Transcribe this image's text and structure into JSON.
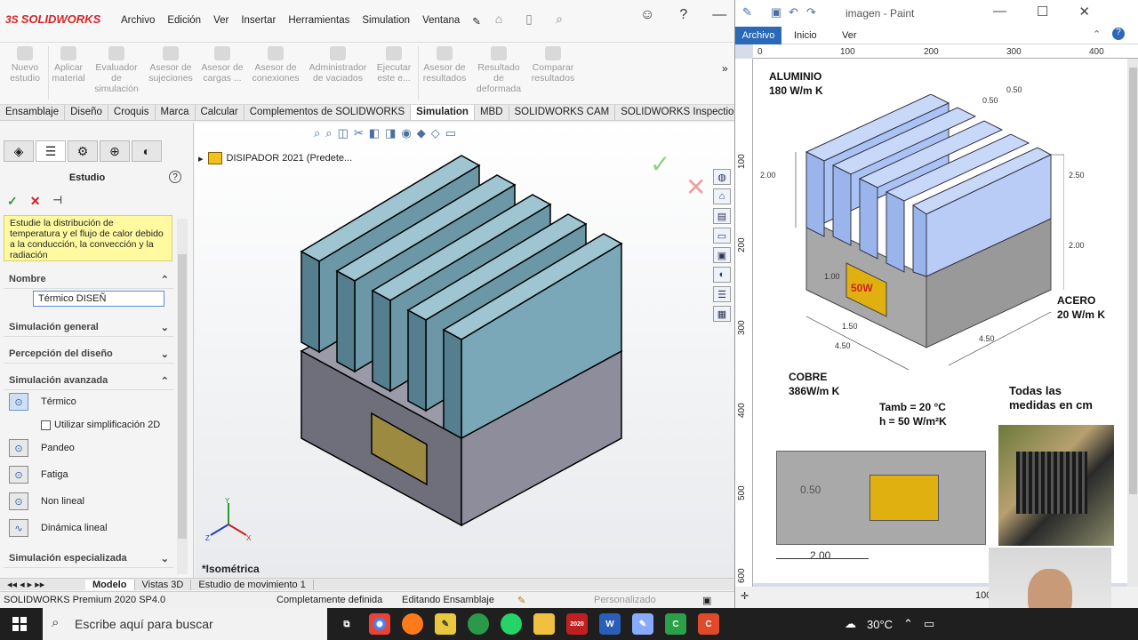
{
  "solidworks": {
    "logo": "SOLIDWORKS",
    "logo_mark": "3S",
    "menu": [
      "Archivo",
      "Edición",
      "Ver",
      "Insertar",
      "Herramientas",
      "Simulation",
      "Ventana"
    ],
    "ribbon": [
      {
        "label": "Nuevo estudio"
      },
      {
        "label": "Aplicar material"
      },
      {
        "label": "Evaluador de simulación"
      },
      {
        "label": "Asesor de sujeciones"
      },
      {
        "label": "Asesor de cargas ..."
      },
      {
        "label": "Asesor de conexiones"
      },
      {
        "label": "Administrador de vaciados"
      },
      {
        "label": "Ejecutar este e..."
      },
      {
        "label": "Asesor de resultados"
      },
      {
        "label": "Resultado de deformada"
      },
      {
        "label": "Comparar resultados"
      }
    ],
    "tabs": [
      "Ensamblaje",
      "Diseño",
      "Croquis",
      "Marca",
      "Calcular",
      "Complementos de SOLIDWORKS",
      "Simulation",
      "MBD",
      "SOLIDWORKS CAM",
      "SOLIDWORKS Inspection"
    ],
    "active_tab": "Simulation",
    "pane": {
      "title": "Estudio",
      "help": "?",
      "info": "Estudie la distribución de temperatura y el flujo de calor debido a la conducción, la convección y la radiación",
      "nombre_label": "Nombre",
      "nombre_value": "Térmico  DISEÑ",
      "sections": [
        "Simulación general",
        "Percepción del diseño",
        "Simulación avanzada",
        "Simulación especializada"
      ],
      "options": [
        "Térmico",
        "Pandeo",
        "Fatiga",
        "Non lineal",
        "Dinámica lineal"
      ],
      "checkbox": "Utilizar simplificación 2D"
    },
    "tree_item": "DISIPADOR 2021  (Predete...",
    "view_label": "*Isométrica",
    "bottom_tabs": [
      "Modelo",
      "Vistas 3D",
      "Estudio de movimiento 1"
    ],
    "status": {
      "version": "SOLIDWORKS Premium 2020 SP4.0",
      "state": "Completamente definida",
      "mode": "Editando Ensamblaje",
      "units": "Personalizado"
    },
    "colors": {
      "fin": "#7aa8b8",
      "base": "#7f7f8e",
      "copper": "#a08a40"
    }
  },
  "paint": {
    "title": "imagen - Paint",
    "file_tab": "Archivo",
    "tabs": [
      "Inicio",
      "Ver"
    ],
    "ruler_h": [
      "0",
      "100",
      "200",
      "300",
      "400"
    ],
    "ruler_v": [
      "100",
      "200",
      "300",
      "400",
      "500",
      "600"
    ],
    "zoom": "100",
    "figure": {
      "aluminio": "ALUMINIO",
      "aluminio_k": "180 W/m K",
      "acero": "ACERO",
      "acero_k": "20 W/m K",
      "cobre": "COBRE",
      "cobre_k": "386W/m K",
      "power": "50W",
      "tamb": "Tamb = 20 °C",
      "h": "h = 50 W/m²K",
      "note1": "Todas las",
      "note2": "medidas en cm",
      "dims": [
        "0.50",
        "0.50",
        "2.00",
        "2.50",
        "2.00",
        "1.00",
        "1.50",
        "4.50",
        "4.50",
        "0.50",
        "2.00"
      ]
    }
  },
  "taskbar": {
    "search": "Escribe aquí para buscar",
    "temp": "30°C",
    "sw_badge": "2020"
  }
}
